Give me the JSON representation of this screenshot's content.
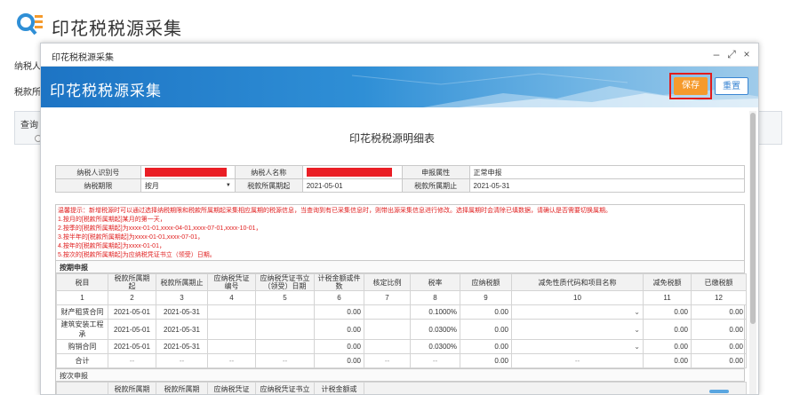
{
  "page": {
    "title": "印花税税源采集",
    "bg_labels": {
      "taxpayer": "纳税人",
      "period": "税款所",
      "query": "查询"
    }
  },
  "modal": {
    "window_title": "印花税税源采集",
    "banner_title": "印花税税源采集",
    "buttons": {
      "save": "保存",
      "reset": "重置"
    },
    "window_controls": {
      "minimize": "–",
      "maximize": "⤢",
      "close": "×"
    }
  },
  "doc": {
    "title": "印花税税源明细表",
    "info": {
      "taxpayer_id_label": "纳税人识别号",
      "taxpayer_name_label": "纳税人名称",
      "declare_attr_label": "申报属性",
      "declare_attr_value": "正常申报",
      "period_label": "纳税期限",
      "period_value": "按月",
      "start_label": "税款所属期起",
      "start_value": "2021-05-01",
      "end_label": "税款所属期止",
      "end_value": "2021-05-31"
    },
    "notes": [
      "温馨提示：新增税源时可以通过选择纳税期限和税款所属期起采集相应属期的税源信息，当查询到有已采集信息时，则带出源采集信息进行修改。选择属期时会清除已填数据，请确认是否需要切换属期。",
      "1.按月的[税款所属期起]某月的第一天，",
      "2.按季的[税款所属期起]为xxxx-01-01,xxxx-04-01,xxxx-07-01,xxxx-10-01，",
      "3.按半年的[税款所属期起]为xxxx-01-01,xxxx-07-01，",
      "4.按年的[税款所属期起]为xxxx-01-01，",
      "5.按次的[税款所属期起]为应纳税凭证书立（领受）日期。"
    ],
    "monthly": {
      "section_title": "按期申报",
      "headers": [
        "税目",
        "税款所属期起",
        "税款所属期止",
        "应纳税凭证编号",
        "应纳税凭证书立（领受）日期",
        "计税金额或件数",
        "核定比例",
        "税率",
        "应纳税额",
        "减免性质代码和项目名称",
        "减免税额",
        "已缴税额"
      ],
      "index_row": [
        "1",
        "2",
        "3",
        "4",
        "5",
        "6",
        "7",
        "8",
        "9",
        "10",
        "11",
        "12"
      ],
      "rows": [
        {
          "item": "财产租赁合同",
          "start": "2021-05-01",
          "end": "2021-05-31",
          "amount": "0.00",
          "rate": "0.1000%",
          "tax": "0.00",
          "relief": "0.00",
          "paid": "0.00"
        },
        {
          "item": "建筑安装工程承",
          "start": "2021-05-01",
          "end": "2021-05-31",
          "amount": "0.00",
          "rate": "0.0300%",
          "tax": "0.00",
          "relief": "0.00",
          "paid": "0.00"
        },
        {
          "item": "购销合同",
          "start": "2021-05-01",
          "end": "2021-05-31",
          "amount": "0.00",
          "rate": "0.0300%",
          "tax": "0.00",
          "relief": "0.00",
          "paid": "0.00"
        }
      ],
      "total": {
        "label": "合计",
        "dash": "--",
        "amount": "0.00",
        "tax": "0.00",
        "relief": "0.00",
        "paid": "0.00"
      }
    },
    "pertime": {
      "section_title": "按次申报",
      "headers_partial": [
        "税款所属期",
        "税款所属期",
        "应纳税凭证",
        "应纳税凭证书立",
        "计税金额或"
      ]
    }
  },
  "colors": {
    "banner": "#1d74c4",
    "save": "#f59a2c",
    "highlight": "#e21b1b",
    "notice": "#e02020",
    "redaction": "#ea1e25"
  }
}
